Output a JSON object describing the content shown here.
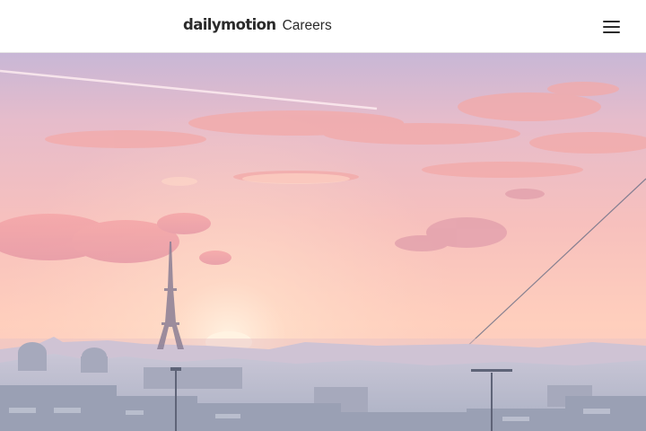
{
  "header": {
    "logo": {
      "wordmark": "dailymotion",
      "section": "Careers"
    },
    "menu_icon": "hamburger-menu-icon"
  },
  "hero": {
    "image": "paris-sunset-skyline-with-eiffel-tower"
  },
  "colors": {
    "header_background": "#ffffff",
    "logo_text": "#2b2b2b",
    "sky_top": "#c9b8d8",
    "sky_glow": "#ffc7b4",
    "sun": "#fff0dc",
    "city": "#b9bfd0"
  }
}
